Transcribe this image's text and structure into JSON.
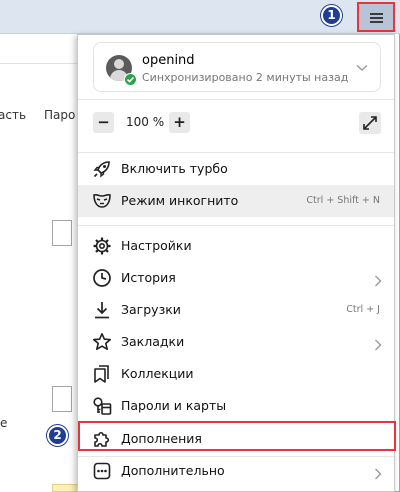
{
  "browser": {
    "menu_button_icon": "hamburger-icon",
    "background_tab_fragment_left": "асть",
    "background_tab_fragment_right": "Паро",
    "background_label_fragment": "е"
  },
  "markers": {
    "first": "1",
    "second": "2"
  },
  "colors": {
    "highlight_red": "#e8343b",
    "marker_blue": "#1f3d95",
    "sync_green": "#2aa24a"
  },
  "profile": {
    "name": "openind",
    "status": "Синхронизировано 2 минуты назад",
    "avatar_icon": "user-avatar-icon",
    "status_icon": "sync-check-icon"
  },
  "zoom": {
    "minus_label": "−",
    "value": "100 %",
    "plus_label": "+",
    "fullscreen_icon": "fullscreen-icon"
  },
  "menu": {
    "turbo": {
      "label": "Включить турбо",
      "icon": "rocket-icon"
    },
    "incognito": {
      "label": "Режим инкогнито",
      "shortcut": "Ctrl + Shift + N",
      "icon": "incognito-mask-icon"
    },
    "settings": {
      "label": "Настройки",
      "icon": "gear-icon"
    },
    "history": {
      "label": "История",
      "icon": "clock-icon"
    },
    "downloads": {
      "label": "Загрузки",
      "shortcut": "Ctrl + J",
      "icon": "download-icon"
    },
    "bookmarks": {
      "label": "Закладки",
      "icon": "star-icon"
    },
    "collections": {
      "label": "Коллекции",
      "icon": "collections-icon"
    },
    "passwords": {
      "label": "Пароли и карты",
      "icon": "key-card-icon"
    },
    "extensions": {
      "label": "Дополнения",
      "icon": "puzzle-icon"
    },
    "more": {
      "label": "Дополнительно",
      "icon": "more-dots-icon"
    }
  }
}
